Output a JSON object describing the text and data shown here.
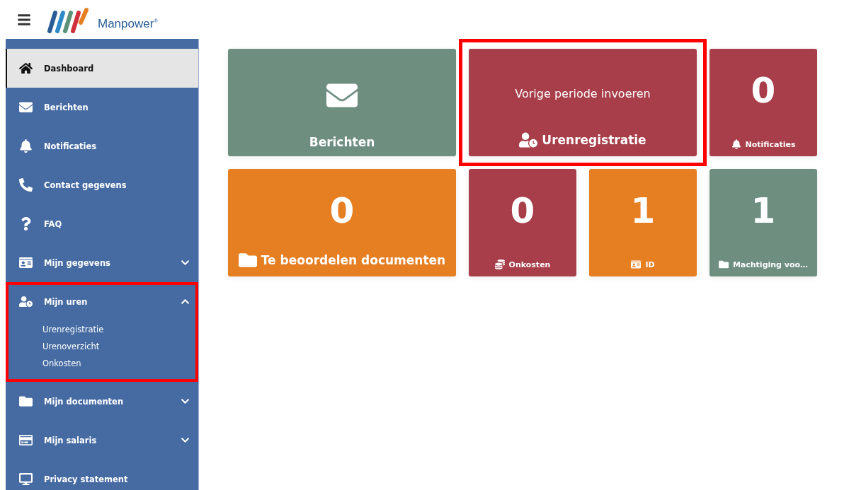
{
  "header": {
    "brand": "Manpower$^{®}$"
  },
  "sidebar": {
    "items": [
      {
        "kind": "link",
        "label": "Dashboard",
        "selected": true
      },
      {
        "kind": "link",
        "label": "Berichten",
        "selected": false
      },
      {
        "kind": "link",
        "label": "Notificaties",
        "selected": false
      },
      {
        "kind": "link",
        "label": "Contact gegevens",
        "selected": false
      },
      {
        "kind": "link",
        "label": "FAQ",
        "selected": false
      },
      {
        "kind": "group",
        "label": "Mijn gegevens",
        "selected": false,
        "expanded": false,
        "highlighted": false
      },
      {
        "kind": "group",
        "label": "Mijn uren",
        "selected": false,
        "expanded": true,
        "highlighted": true,
        "children": [
          {
            "label": "Urenregistratie"
          },
          {
            "label": "Urenoverzicht"
          },
          {
            "label": "Onkosten"
          }
        ]
      },
      {
        "kind": "group",
        "label": "Mijn documenten",
        "selected": false,
        "expanded": false,
        "highlighted": false
      },
      {
        "kind": "group",
        "label": "Mijn salaris",
        "selected": false,
        "expanded": false,
        "highlighted": false
      },
      {
        "kind": "link",
        "label": "Privacy statement",
        "selected": false
      }
    ]
  },
  "tiles": [
    {
      "kind": "icon",
      "label": "Berichten",
      "color": "#6e8e80",
      "wide": true,
      "highlighted": false
    },
    {
      "kind": "subtitle",
      "subtitle": "Vorige periode invoeren",
      "label": "Urenregistratie",
      "color": "#a83e4a",
      "wide": true,
      "highlighted": true
    },
    {
      "kind": "count",
      "count": "0",
      "label": "Notificaties",
      "color": "#a83e4a",
      "wide": false,
      "highlighted": false
    },
    {
      "kind": "count",
      "count": "0",
      "label": "Te beoordelen documenten",
      "color": "#e67e22",
      "wide": true,
      "highlighted": false
    },
    {
      "kind": "count",
      "count": "0",
      "label": "Onkosten",
      "color": "#a83e4a",
      "wide": false,
      "highlighted": false
    },
    {
      "kind": "count",
      "count": "1",
      "label": "ID",
      "color": "#e67e22",
      "wide": false,
      "highlighted": false
    },
    {
      "kind": "count",
      "count": "1",
      "label": "Machtiging voo…",
      "color": "#6e8e80",
      "wide": false,
      "highlighted": false
    }
  ]
}
